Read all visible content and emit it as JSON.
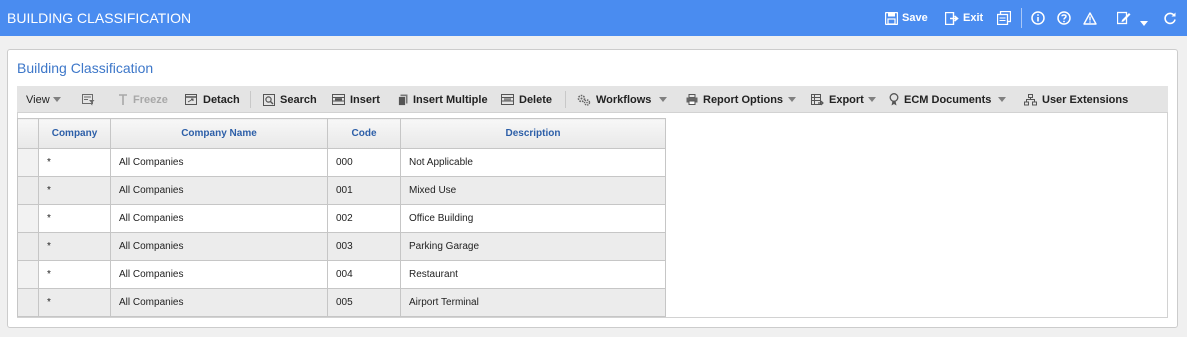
{
  "window": {
    "title": "BUILDING CLASSIFICATION",
    "actions": {
      "save": "Save",
      "exit": "Exit"
    }
  },
  "panel": {
    "title": "Building Classification"
  },
  "toolbar": {
    "view": "View",
    "freeze": "Freeze",
    "detach": "Detach",
    "search": "Search",
    "insert": "Insert",
    "insert_multiple": "Insert Multiple",
    "delete": "Delete",
    "workflows": "Workflows",
    "report_options": "Report Options",
    "export": "Export",
    "ecm_documents": "ECM Documents",
    "user_extensions": "User Extensions"
  },
  "table": {
    "columns": [
      "Company",
      "Company Name",
      "Code",
      "Description"
    ],
    "rows": [
      [
        "*",
        "All Companies",
        "000",
        "Not Applicable"
      ],
      [
        "*",
        "All Companies",
        "001",
        "Mixed Use"
      ],
      [
        "*",
        "All Companies",
        "002",
        "Office Building"
      ],
      [
        "*",
        "All Companies",
        "003",
        "Parking Garage"
      ],
      [
        "*",
        "All Companies",
        "004",
        "Restaurant"
      ],
      [
        "*",
        "All Companies",
        "005",
        "Airport Terminal"
      ]
    ]
  },
  "colors": {
    "titlebar": "#4a8cf0",
    "panel_title": "#3d77c9",
    "header_text": "#2d5fa8"
  }
}
